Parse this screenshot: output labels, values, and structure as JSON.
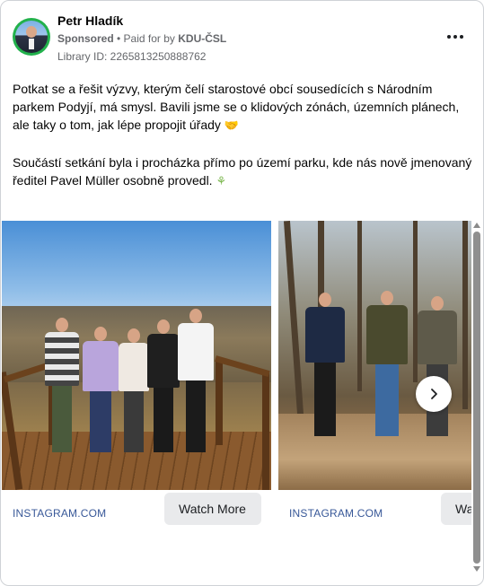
{
  "post": {
    "author": "Petr Hladík",
    "sponsored_label": "Sponsored",
    "paid_prefix": " • Paid for by ",
    "payer": "KDU-ČSL",
    "library_id": "Library ID: 2265813250888762",
    "paragraph1": "Potkat se a řešit výzvy, kterým čelí starostové obcí sousedících s Národním parkem Podyjí, má smysl. Bavili jsme se o klidových zónách, územních plánech, ale taky o tom, jak lépe propojit úřady",
    "paragraph2": "Součástí setkání byla i procházka přímo po území parku, kde nás nově jmenovaný ředitel Pavel Müller osobně provedl.",
    "ellipsis": "...",
    "emoji_handshake": "handshake-emoji",
    "emoji_leaf": "seedling-emoji"
  },
  "carousel": {
    "slides": [
      {
        "source": "INSTAGRAM.COM",
        "button": "Watch More",
        "image": "group-photo-on-wooden-lookout"
      },
      {
        "source": "INSTAGRAM.COM",
        "button": "Watch More",
        "image": "group-walking-in-forest"
      }
    ],
    "next_icon": "chevron-right-icon"
  },
  "icons": {
    "more": "more-horizontal-icon",
    "avatar": "profile-avatar"
  },
  "colors": {
    "link": "#385898",
    "meta": "#65676b",
    "avatar_ring": "#22b14c",
    "button_bg": "#e9eaec"
  }
}
